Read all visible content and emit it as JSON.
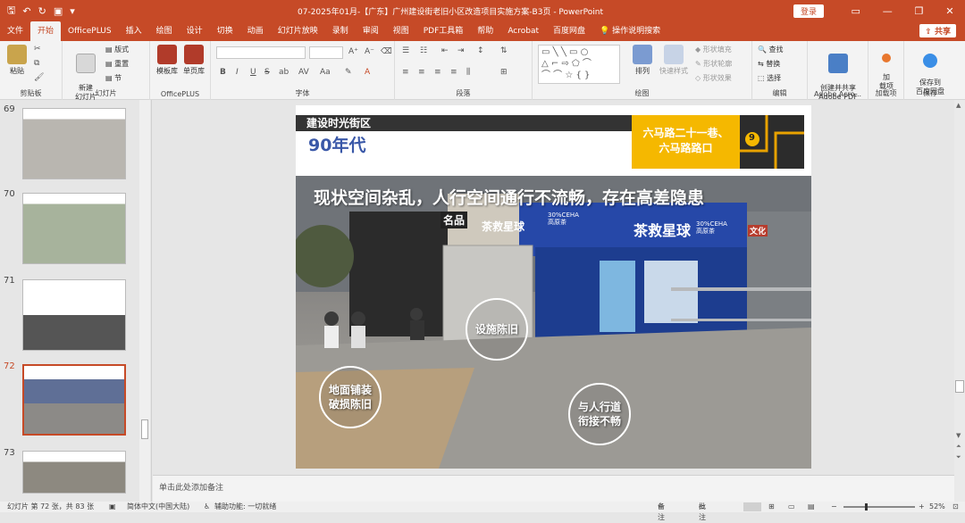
{
  "window": {
    "title": "07-2025年01月-【广东】广州建设街老旧小区改造项目实施方案-B3页 - PowerPoint",
    "login_label": "登录"
  },
  "tabs": [
    {
      "label": "文件"
    },
    {
      "label": "开始"
    },
    {
      "label": "OfficePLUS"
    },
    {
      "label": "插入"
    },
    {
      "label": "绘图"
    },
    {
      "label": "设计"
    },
    {
      "label": "切换"
    },
    {
      "label": "动画"
    },
    {
      "label": "幻灯片放映"
    },
    {
      "label": "录制"
    },
    {
      "label": "审阅"
    },
    {
      "label": "视图"
    },
    {
      "label": "PDF工具箱"
    },
    {
      "label": "帮助"
    },
    {
      "label": "Acrobat"
    },
    {
      "label": "百度网盘"
    },
    {
      "label": "操作说明搜索"
    }
  ],
  "share_label": "共享",
  "ribbon": {
    "clipboard": {
      "paste": "粘贴",
      "label": "剪贴板"
    },
    "slides": {
      "new_slide": "新建\n幻灯片",
      "layout": "版式",
      "reset": "重置",
      "section": "节",
      "label": "幻灯片"
    },
    "officeplus": {
      "template": "模板库",
      "single": "单页库",
      "label": "OfficePLUS"
    },
    "font": {
      "label": "字体",
      "bold": "B",
      "italic": "I",
      "underline": "U",
      "strike": "S",
      "shadow": "ab",
      "spacing": "AV",
      "case": "Aa",
      "color": "A"
    },
    "paragraph": {
      "label": "段落"
    },
    "drawing": {
      "arrange": "排列",
      "quick_styles": "快速样式",
      "fill": "形状填充",
      "outline": "形状轮廓",
      "effects": "形状效果",
      "label": "绘图"
    },
    "editing": {
      "find": "查找",
      "replace": "替换",
      "select": "选择",
      "label": "编辑"
    },
    "adobe": {
      "create": "创建并共享\nAdobe PDF",
      "label": "Adobe Acro..."
    },
    "addins": {
      "addin": "加\n载项",
      "label": "加载项"
    },
    "save": {
      "baidu": "保存到\n百度网盘",
      "label": "保存"
    }
  },
  "thumbnails": [
    {
      "number": "69"
    },
    {
      "number": "70"
    },
    {
      "number": "71"
    },
    {
      "number": "72",
      "active": true
    },
    {
      "number": "73"
    }
  ],
  "slide": {
    "section_title": "建设时光街区",
    "era": "90年代",
    "location": "六马路二十一巷、\n六马路路口",
    "map_number": "9",
    "headline": "现状空间杂乱，人行空间通行不流畅，存在高差隐患",
    "labels": {
      "facility": "设施陈旧",
      "pavement": "地面铺装\n破损陈旧",
      "sidewalk": "与人行道\n衔接不畅"
    },
    "signs": {
      "brand1": "茶救星球",
      "brand2": "茶救星球",
      "brand1_sub": "30%CEHA\n高原茶",
      "brand2_sub": "30%CEHA\n高原茶",
      "shop_left": "名品",
      "shop_side": "文化"
    }
  },
  "notes_placeholder": "单击此处添加备注",
  "status": {
    "slide_info": "幻灯片 第 72 张，共 83 张",
    "language": "简体中文(中国大陆)",
    "accessibility": "辅助功能: 一切就绪",
    "notes": "备注",
    "comments": "批注",
    "zoom": "52%"
  },
  "colors": {
    "accent": "#c64a27",
    "slide_blue": "#3a58a8",
    "slide_yellow": "#f5b800"
  }
}
